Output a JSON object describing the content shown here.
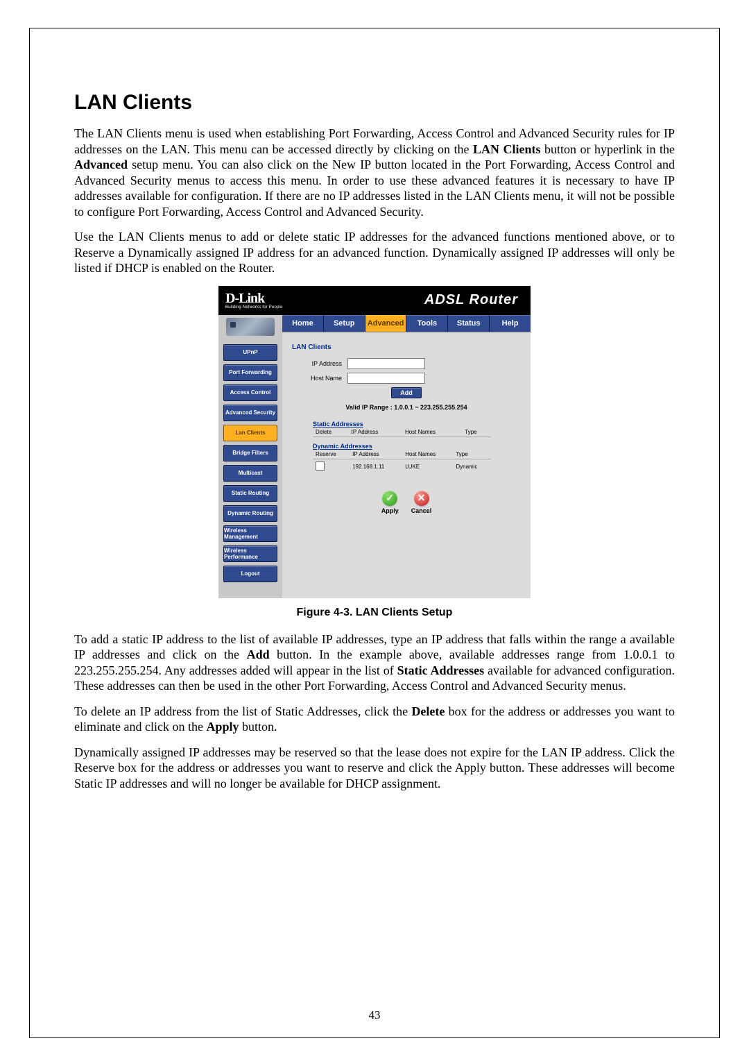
{
  "page_number": "43",
  "title": "LAN Clients",
  "paragraphs": {
    "p1_a": "The LAN Clients menu is used when establishing Port Forwarding, Access Control and Advanced Security rules for IP addresses on the LAN. This menu can be accessed directly by clicking on the ",
    "p1_b": "LAN Clients",
    "p1_c": " button or hyperlink in the ",
    "p1_d": "Advanced",
    "p1_e": " setup menu. You can also click on the New IP button located in the Port Forwarding, Access Control and Advanced Security menus to access this menu. In order to use these advanced features it is necessary to have IP addresses available for configuration. If there are no IP addresses listed in the LAN Clients menu, it will not be possible to configure Port Forwarding, Access Control and Advanced Security.",
    "p2": "Use the LAN Clients menus to add or delete static IP addresses for the advanced functions mentioned above, or to Reserve a Dynamically assigned IP address for an advanced function. Dynamically assigned IP addresses will only be listed if DHCP is enabled on the Router.",
    "p3_a": "To add a static IP address to the list of available IP addresses, type an IP address that falls within the range a available IP addresses and click on the ",
    "p3_b": "Add",
    "p3_c": " button. In the example above, available addresses range from 1.0.0.1 to 223.255.255.254. Any addresses added will appear in the list of ",
    "p3_d": "Static Addresses",
    "p3_e": " available for advanced configuration. These addresses can then be used in the other Port Forwarding, Access Control and Advanced Security menus.",
    "p4_a": "To delete an IP address from the list of Static Addresses, click the ",
    "p4_b": "Delete",
    "p4_c": " box for the address or addresses you want to eliminate and click on the ",
    "p4_d": "Apply",
    "p4_e": " button.",
    "p5": "Dynamically assigned IP addresses may be reserved so that the lease does not expire for the LAN IP address. Click the Reserve box for the address or addresses you want to reserve and click the Apply button. These addresses will become Static IP addresses and will no longer be available for DHCP assignment."
  },
  "figure_caption": "Figure 4-3. LAN Clients Setup",
  "router": {
    "logo_big": "D-Link",
    "logo_tag": "Building Networks for People",
    "header_title": "ADSL Router",
    "topnav": [
      "Home",
      "Setup",
      "Advanced",
      "Tools",
      "Status",
      "Help"
    ],
    "topnav_active": "Advanced",
    "side": [
      "UPnP",
      "Port Forwarding",
      "Access Control",
      "Advanced Security",
      "Lan Clients",
      "Bridge Filters",
      "Multicast",
      "Static Routing",
      "Dynamic Routing",
      "Wireless Management",
      "Wireless Performance",
      "Logout"
    ],
    "side_active": "Lan Clients",
    "panel_title": "LAN Clients",
    "labels": {
      "ip": "IP Address",
      "host": "Host Name"
    },
    "buttons": {
      "add": "Add",
      "apply": "Apply",
      "cancel": "Cancel"
    },
    "range_prefix": "Valid IP Range :  ",
    "range_value": "1.0.0.1 ~ 223.255.255.254",
    "static_title": "Static Addresses",
    "static_headers": [
      "Delete",
      "IP Address",
      "Host Names",
      "Type"
    ],
    "dynamic_title": "Dynamic Addresses",
    "dynamic_headers": [
      "Reserve",
      "IP Address",
      "Host Names",
      "Type"
    ],
    "dynamic_rows": [
      {
        "ip": "192.168.1.11",
        "host": "LUKE",
        "type": "Dynamic"
      }
    ]
  }
}
